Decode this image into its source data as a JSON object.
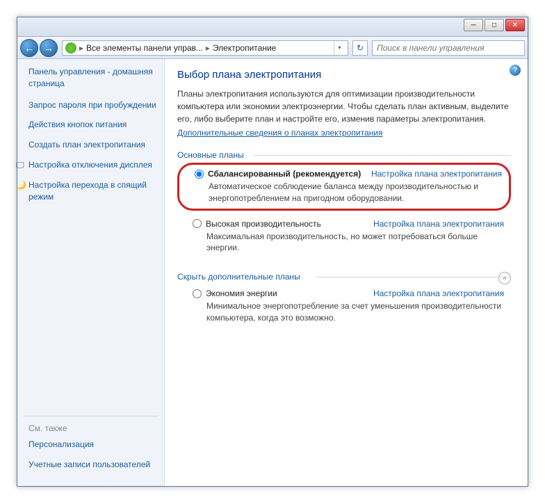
{
  "breadcrumb": {
    "item1": "Все элементы панели управ...",
    "item2": "Электропитание"
  },
  "search": {
    "placeholder": "Поиск в панели управления"
  },
  "sidebar": {
    "home": "Панель управления - домашняя страница",
    "links": [
      "Запрос пароля при пробуждении",
      "Действия кнопок питания",
      "Создать план электропитания",
      "Настройка отключения дисплея",
      "Настройка перехода в спящий режим"
    ],
    "see_also_label": "См. также",
    "see_also": [
      "Персонализация",
      "Учетные записи пользователей"
    ]
  },
  "main": {
    "title": "Выбор плана электропитания",
    "description": "Планы электропитания используются для оптимизации производительности компьютера или экономии электроэнергии. Чтобы сделать план активным, выделите его, либо выберите план и настройте его, изменив параметры электропитания.",
    "more_info": "Дополнительные сведения о планах электропитания",
    "basic_label": "Основные планы",
    "additional_label": "Скрыть дополнительные планы",
    "plans": [
      {
        "name": "Сбалансированный (рекомендуется)",
        "desc": "Автоматическое соблюдение баланса между производительностью и энергопотреблением на пригодном оборудовании."
      },
      {
        "name": "Высокая производительность",
        "desc": "Максимальная производительность, но может потребоваться больше энергии."
      },
      {
        "name": "Экономия энергии",
        "desc": "Минимальное энергопотребление за счет уменьшения производительности компьютера, когда это возможно."
      }
    ],
    "change_link": "Настройка плана электропитания"
  }
}
